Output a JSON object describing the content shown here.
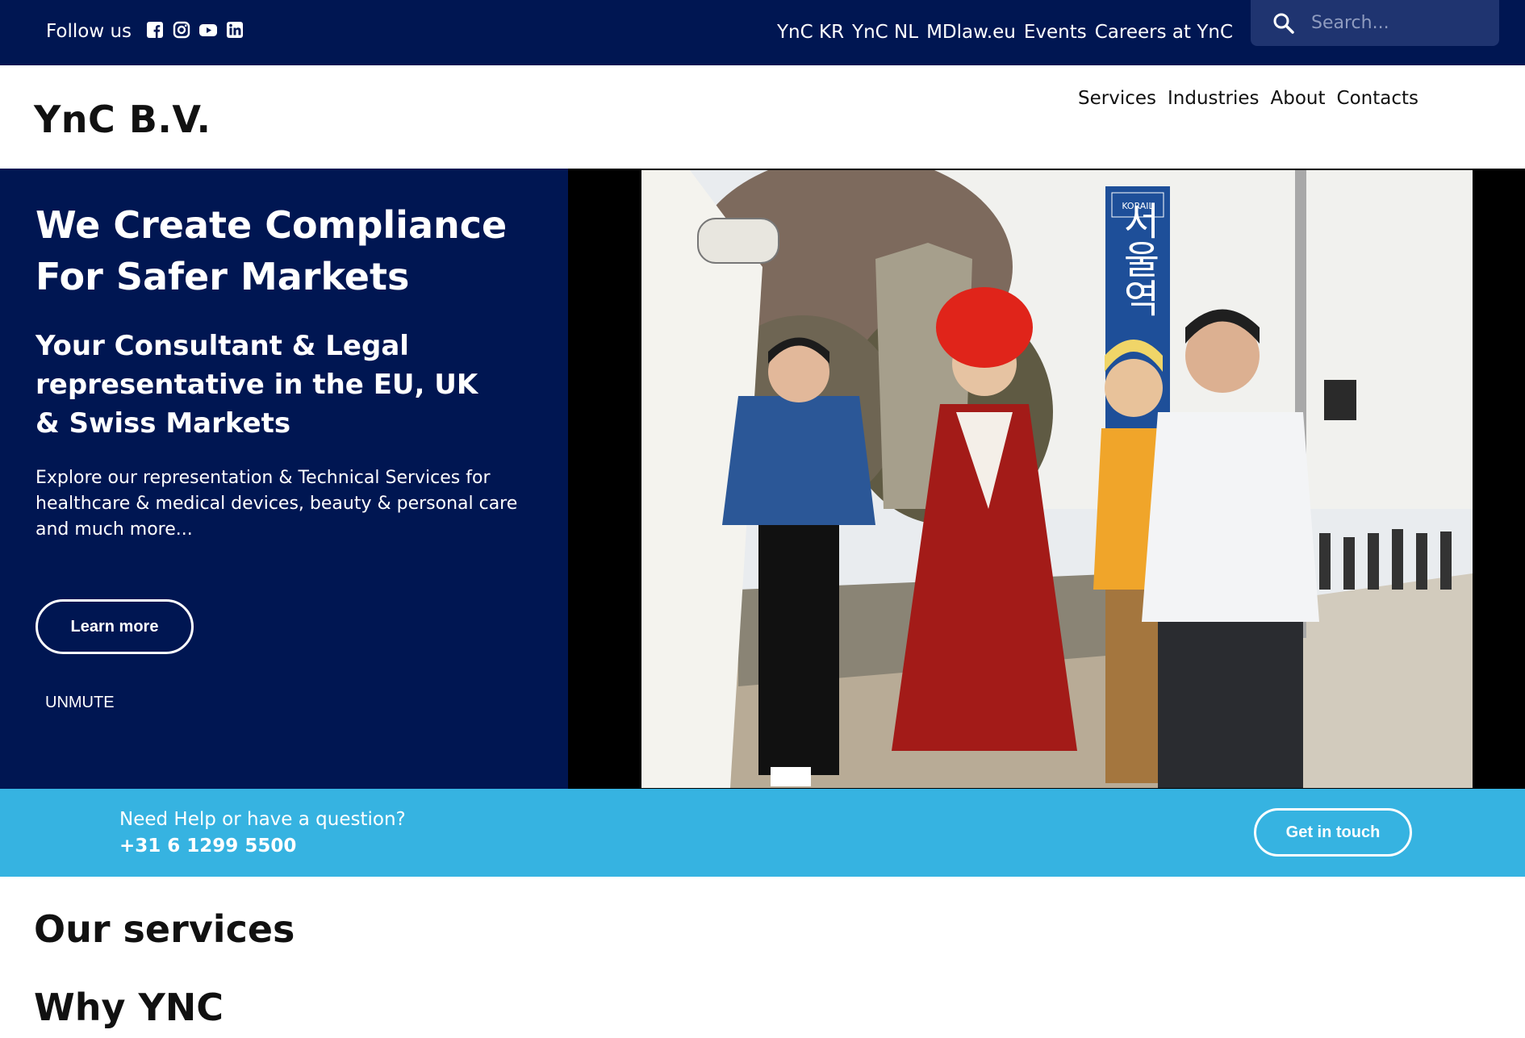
{
  "topbar": {
    "follow_label": "Follow us",
    "social_icons": [
      "facebook-icon",
      "instagram-icon",
      "youtube-icon",
      "linkedin-icon"
    ],
    "links": [
      "YnC KR",
      "YnC NL",
      "MDlaw.eu",
      "Events",
      "Careers at YnC"
    ],
    "search_placeholder": "Search..."
  },
  "header": {
    "logo": "YnC B.V.",
    "nav": [
      "Services",
      "Industries",
      "About",
      "Contacts"
    ]
  },
  "hero": {
    "title": "We Create Compliance For Safer Markets",
    "subtitle": "Your Consultant & Legal representative in the EU, UK & Swiss Markets",
    "description": "Explore our representation & Technical Services for healthcare & medical devices, beauty & personal care and much more...",
    "learn_more": "Learn more",
    "unmute": "UNMUTE",
    "sign_text": "서울역",
    "sign_brand": "KORAIL"
  },
  "help": {
    "question": "Need Help or have a question?",
    "phone": "+31 6 1299 5500",
    "button": "Get in touch"
  },
  "sections": {
    "services": "Our services",
    "why": "Why YNC"
  },
  "colors": {
    "navy": "#001652",
    "sky": "#36b3e1"
  }
}
